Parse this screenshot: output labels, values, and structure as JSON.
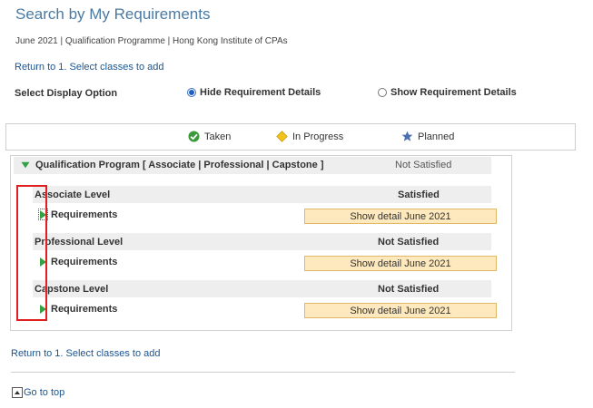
{
  "header": {
    "title": "Search by My Requirements",
    "subtitle": "June 2021 | Qualification Programme | Hong Kong Institute of CPAs"
  },
  "links": {
    "return_top": "Return to 1. Select classes to add",
    "return_bottom": "Return to 1. Select classes to add",
    "go_to_top": "Go to top"
  },
  "display_option": {
    "label": "Select Display Option",
    "options": [
      {
        "label": "Hide Requirement Details",
        "selected": true
      },
      {
        "label": "Show Requirement Details",
        "selected": false
      }
    ]
  },
  "legend": {
    "items": [
      {
        "label": "Taken",
        "icon": "check-icon",
        "color": "#3a9a3a"
      },
      {
        "label": "In Progress",
        "icon": "diamond-icon",
        "color": "#f2c21b"
      },
      {
        "label": "Planned",
        "icon": "star-icon",
        "color": "#4a6fb0"
      }
    ]
  },
  "program": {
    "label": "Qualification Program [ Associate | Professional | Capstone ]",
    "status": "Not Satisfied",
    "levels": [
      {
        "name": "Associate Level",
        "status": "Satisfied",
        "req_label": "Requirements",
        "button": "Show detail June 2021"
      },
      {
        "name": "Professional Level",
        "status": "Not Satisfied",
        "req_label": "Requirements",
        "button": "Show detail June 2021"
      },
      {
        "name": "Capstone Level",
        "status": "Not Satisfied",
        "req_label": "Requirements",
        "button": "Show detail June 2021"
      }
    ]
  },
  "colors": {
    "accent_link": "#1a5590",
    "title": "#4a7aa3",
    "button_bg": "#fde9bd",
    "highlight_box": "#e02020",
    "expand_triangle": "#33a244"
  }
}
